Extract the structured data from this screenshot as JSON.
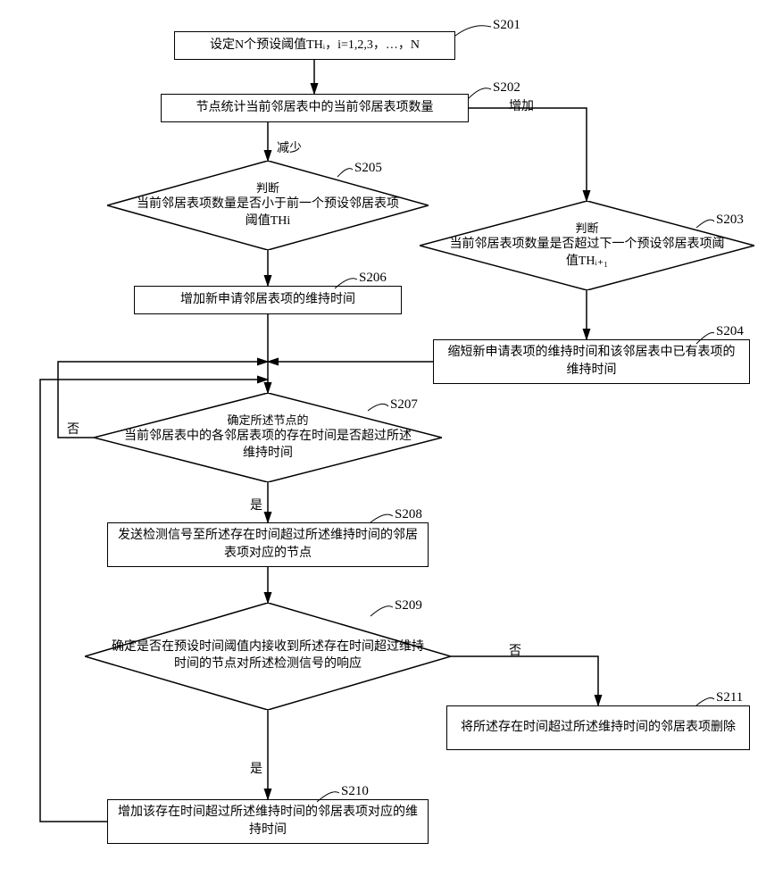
{
  "nodes": {
    "s201": {
      "label": "S201",
      "text": "设定N个预设阈值THᵢ，i=1,2,3，…，N"
    },
    "s202": {
      "label": "S202",
      "text": "节点统计当前邻居表中的当前邻居表项数量"
    },
    "s203": {
      "label": "S203",
      "head": "判断",
      "text": "当前邻居表项数量是否超过下一个预设邻居表项阈值THᵢ₊₁"
    },
    "s204": {
      "label": "S204",
      "text": "缩短新申请表项的维持时间和该邻居表中已有表项的维持时间"
    },
    "s205": {
      "label": "S205",
      "head": "判断",
      "text": "当前邻居表项数量是否小于前一个预设邻居表项阈值THi"
    },
    "s206": {
      "label": "S206",
      "text": "增加新申请邻居表项的维持时间"
    },
    "s207": {
      "label": "S207",
      "head": "确定所述节点的",
      "text": "当前邻居表中的各邻居表项的存在时间是否超过所述维持时间"
    },
    "s208": {
      "label": "S208",
      "text": "发送检测信号至所述存在时间超过所述维持时间的邻居表项对应的节点"
    },
    "s209": {
      "label": "S209",
      "text": "确定是否在预设时间阈值内接收到所述存在时间超过维持时间的节点对所述检测信号的响应"
    },
    "s210": {
      "label": "S210",
      "text": "增加该存在时间超过所述维持时间的邻居表项对应的维持时间"
    },
    "s211": {
      "label": "S211",
      "text": "将所述存在时间超过所述维持时间的邻居表项删除"
    }
  },
  "edges": {
    "increase": "增加",
    "decrease": "减少",
    "yes": "是",
    "no": "否"
  }
}
